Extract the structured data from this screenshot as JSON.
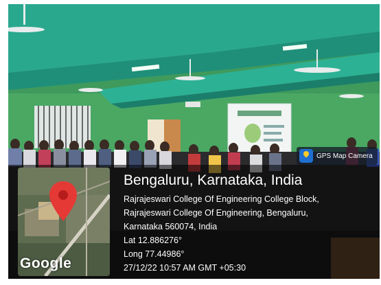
{
  "badge": {
    "label": "GPS Map Camera",
    "icon": "map-pin-app-icon"
  },
  "map": {
    "logo": "Google",
    "marker_color": "#e53935"
  },
  "location": {
    "city": "Bengaluru, Karnataka, India",
    "address_lines": [
      "Rajrajeswari College Of Engineering College Block,",
      "Rajrajeswari College Of Engineering, Bengaluru,",
      "Karnataka 560074, India"
    ],
    "lat": "Lat 12.886276°",
    "long": "Long 77.44986°",
    "datetime": "27/12/22 10:57 AM GMT +05:30"
  },
  "colors": {
    "wall": "#3f9a5c",
    "ceiling": "#26a58c",
    "overlay_text": "#ffffff"
  }
}
